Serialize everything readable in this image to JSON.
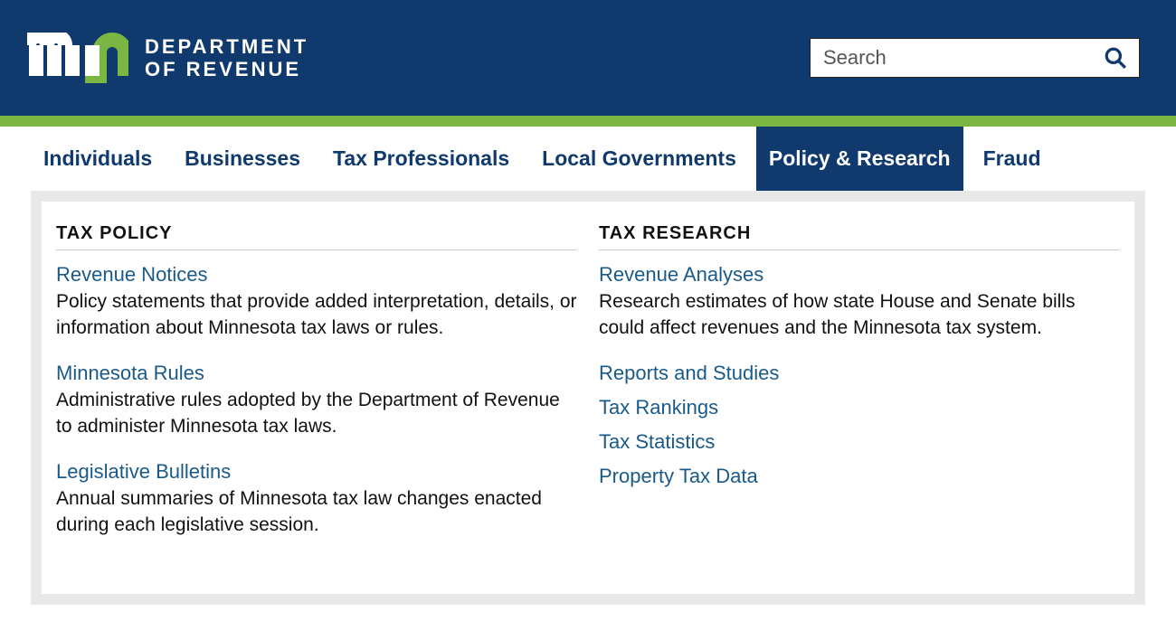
{
  "header": {
    "dept_line1": "DEPARTMENT",
    "dept_line2": "OF REVENUE",
    "search_placeholder": "Search"
  },
  "nav": {
    "items": [
      {
        "label": "Individuals",
        "active": false
      },
      {
        "label": "Businesses",
        "active": false
      },
      {
        "label": "Tax Professionals",
        "active": false
      },
      {
        "label": "Local Governments",
        "active": false
      },
      {
        "label": "Policy & Research",
        "active": true
      },
      {
        "label": "Fraud",
        "active": false
      }
    ]
  },
  "mega": {
    "col1": {
      "heading": "TAX POLICY",
      "items": [
        {
          "title": "Revenue Notices",
          "desc": "Policy statements that provide added interpretation, details, or information about Minnesota tax laws or rules."
        },
        {
          "title": "Minnesota Rules",
          "desc": "Administrative rules adopted by the Department of Revenue to administer Minnesota tax laws."
        },
        {
          "title": "Legislative Bulletins",
          "desc": "Annual summaries of Minnesota tax law changes enacted during each legislative session."
        }
      ]
    },
    "col2": {
      "heading": "TAX RESEARCH",
      "lead": {
        "title": "Revenue Analyses",
        "desc": "Research estimates of how state House and Senate bills could affect revenues and the Minnesota tax system."
      },
      "links": [
        "Reports and Studies",
        "Tax Rankings",
        "Tax Statistics",
        "Property Tax Data"
      ]
    }
  }
}
